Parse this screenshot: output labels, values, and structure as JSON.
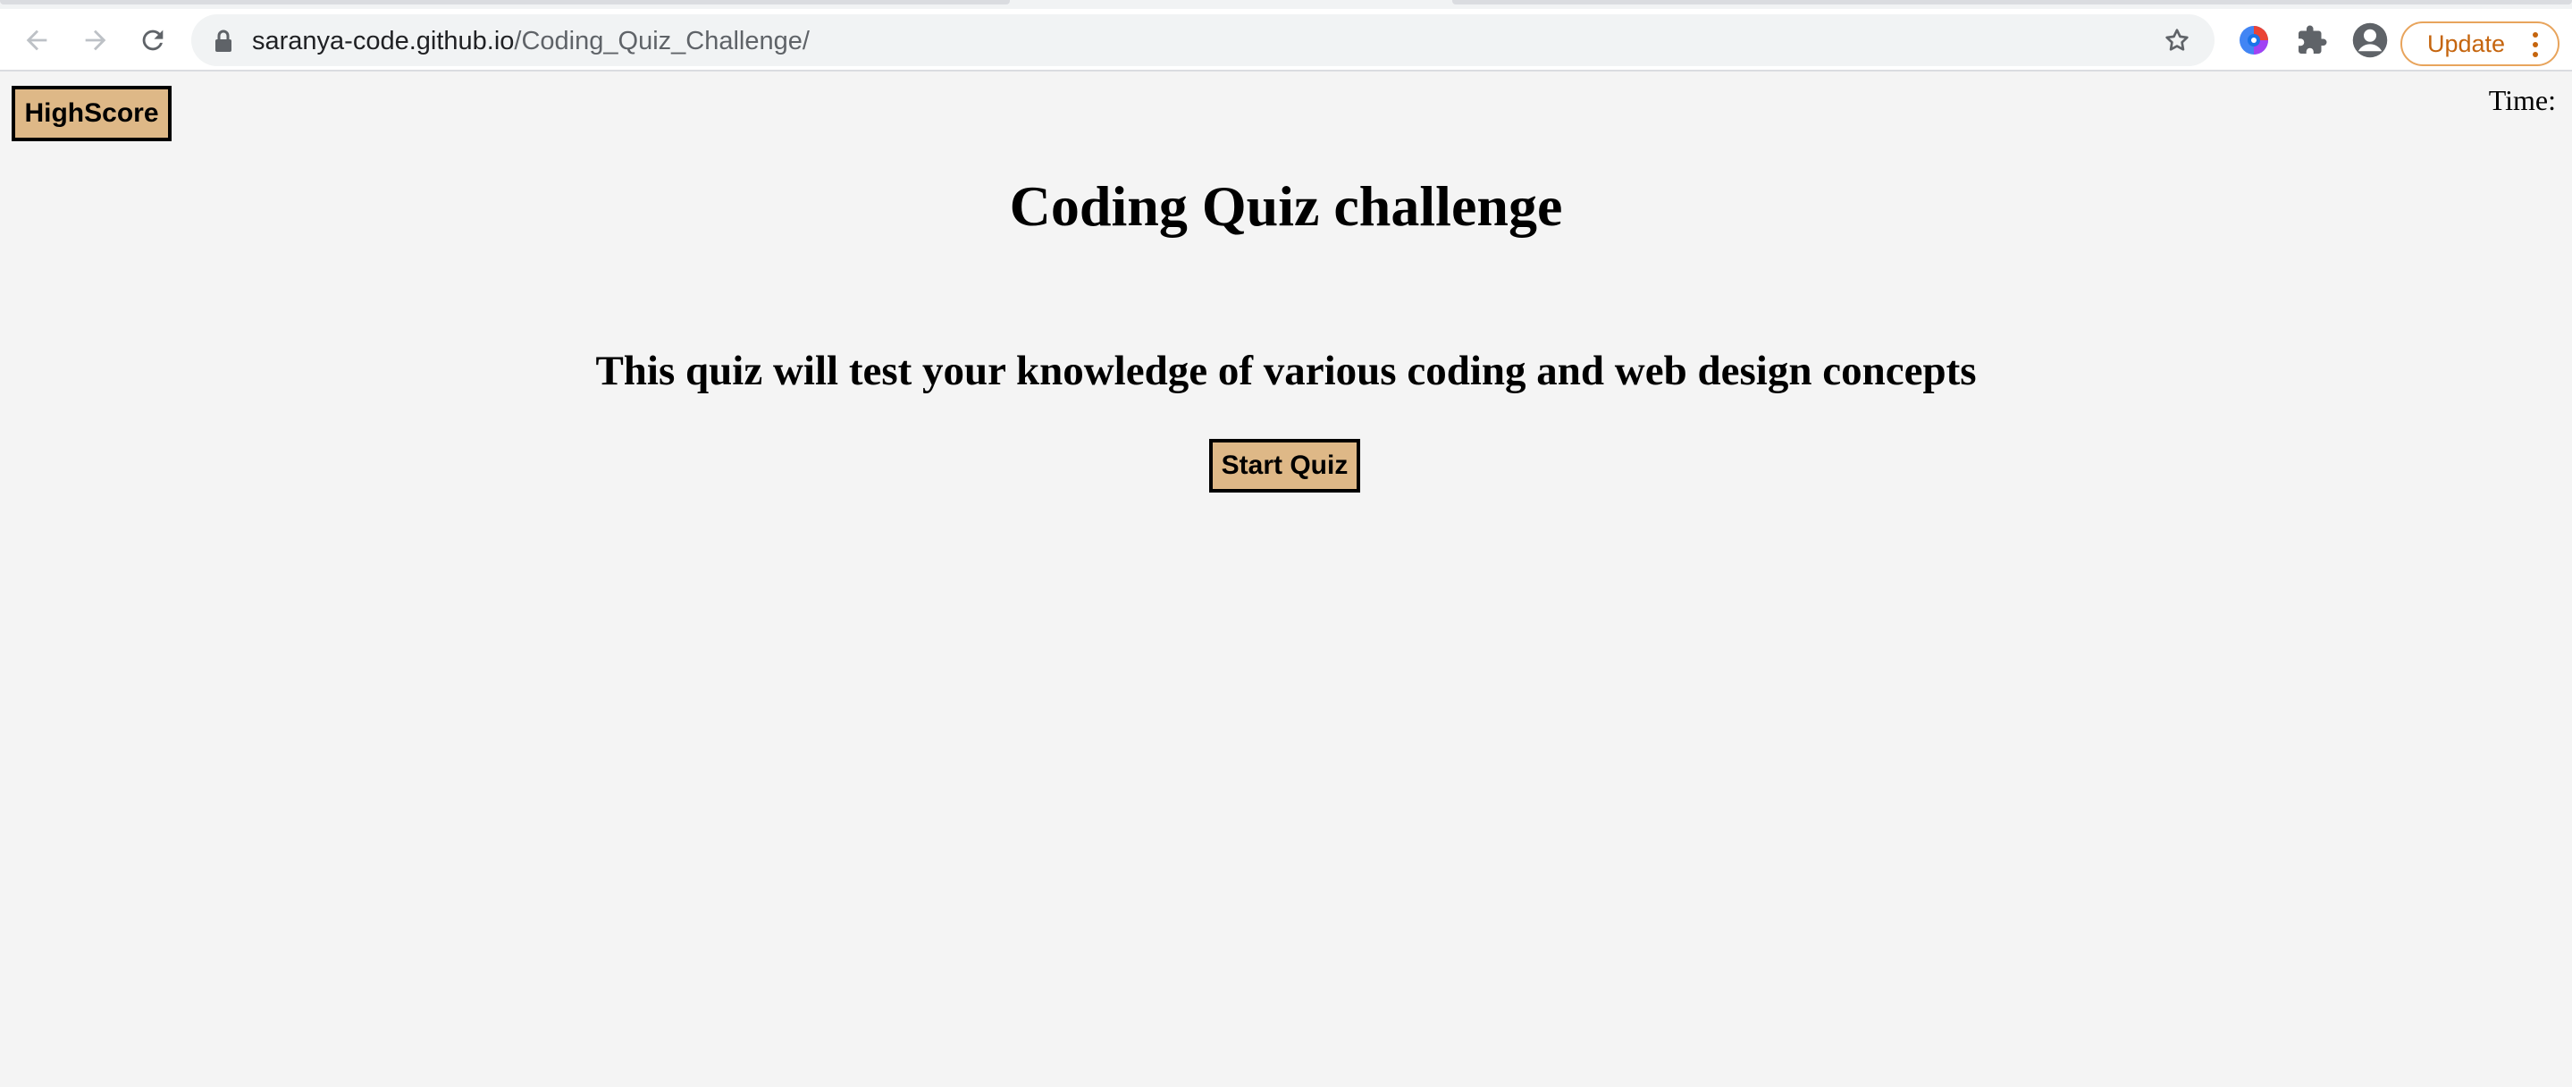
{
  "browser": {
    "url_host": "saranya-code.github.io",
    "url_path": "/Coding_Quiz_Challenge/",
    "update_label": "Update",
    "icons": {
      "back": "arrow-left-icon",
      "forward": "arrow-right-icon",
      "reload": "reload-icon",
      "lock": "lock-icon",
      "bookmark": "star-icon",
      "extension": "color-wheel-extension-icon",
      "extensions_menu": "puzzle-icon",
      "profile": "profile-icon",
      "menu": "kebab-menu-icon"
    },
    "update_color": "#c5650e"
  },
  "page": {
    "highscore_label": "HighScore",
    "time_label": "Time:",
    "title": "Coding Quiz challenge",
    "description": "This quiz will test your knowledge of various coding and web design concepts",
    "start_label": "Start Quiz",
    "button_color": "#deb887",
    "background_color": "#f4f4f4"
  }
}
